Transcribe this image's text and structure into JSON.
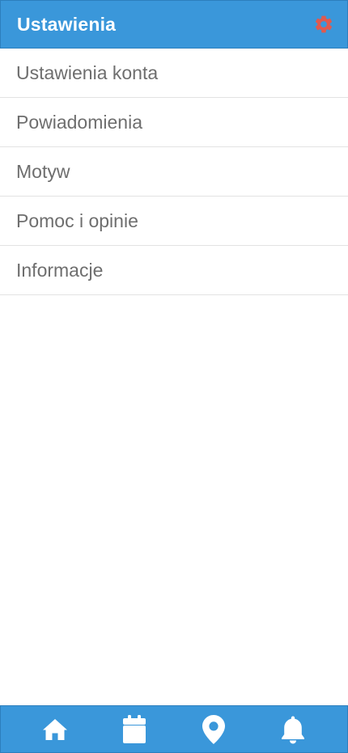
{
  "header": {
    "title": "Ustawienia",
    "settings_icon": "gear-icon",
    "settings_icon_color": "#e05a4f"
  },
  "menu": {
    "items": [
      {
        "label": "Ustawienia konta"
      },
      {
        "label": "Powiadomienia"
      },
      {
        "label": "Motyw"
      },
      {
        "label": "Pomoc i opinie"
      },
      {
        "label": "Informacje"
      }
    ]
  },
  "tabbar": {
    "tabs": [
      {
        "icon": "home-icon"
      },
      {
        "icon": "calendar-icon"
      },
      {
        "icon": "map-pin-icon"
      },
      {
        "icon": "bell-icon"
      }
    ]
  },
  "colors": {
    "primary": "#3a97da",
    "text": "#6e6e6e",
    "divider": "#e3e3e3",
    "accent": "#e05a4f"
  }
}
